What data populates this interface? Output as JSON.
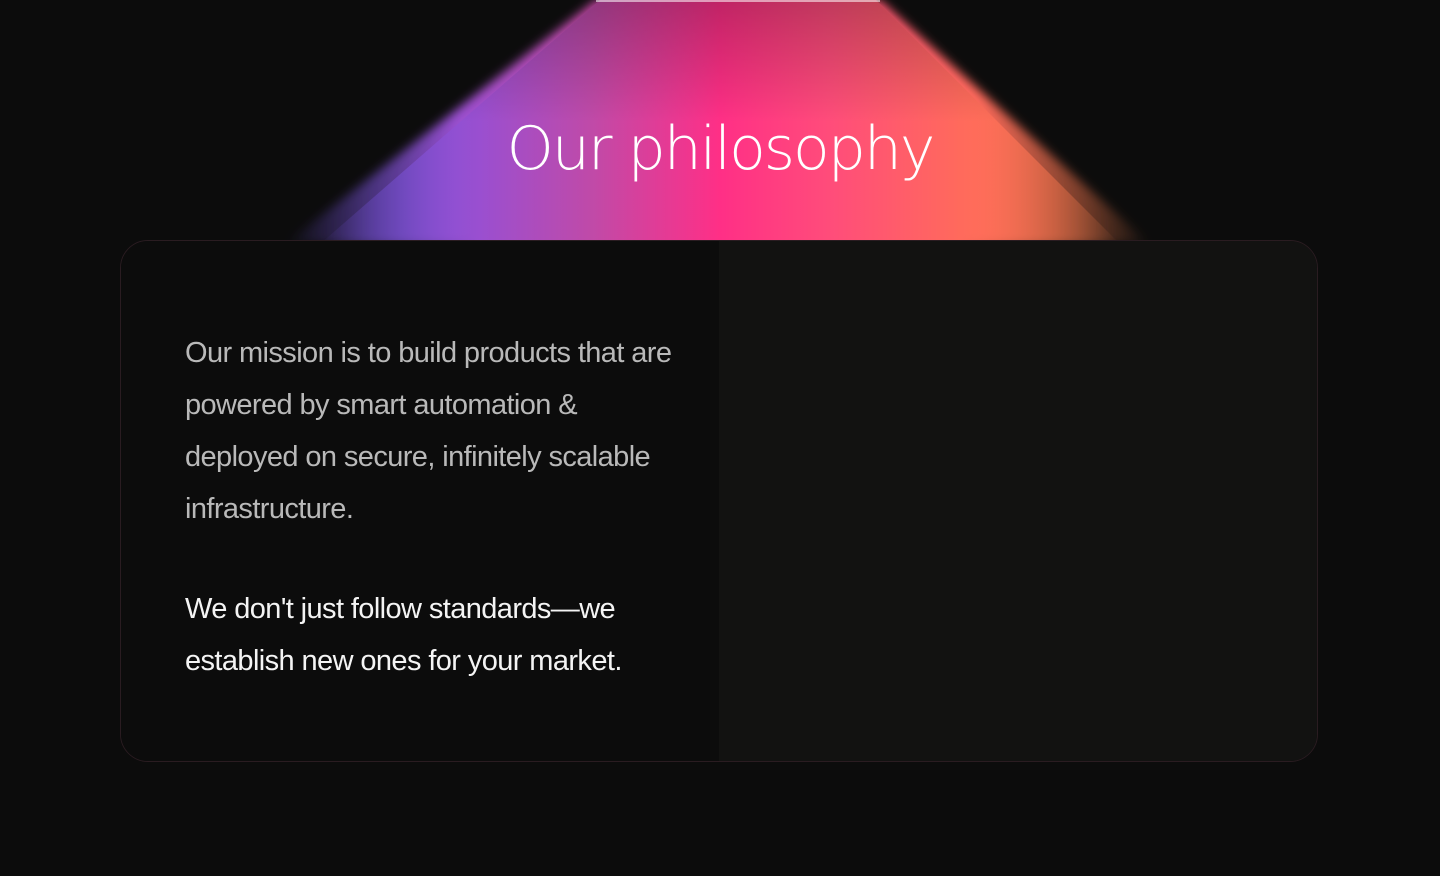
{
  "section": {
    "title": "Our philosophy"
  },
  "card": {
    "mission_text": "Our mission is to build products that are powered by smart automation & deployed on secure, infinitely scalable infrastructure.",
    "standards_text": "We don't just follow standards—we establish new ones for your market."
  },
  "colors": {
    "background": "#0c0c0c",
    "beam_purple": "#8e4fd6",
    "beam_pink": "#ff2f86",
    "beam_coral": "#ff6a5c",
    "card_right_panel": "#121211",
    "mission_text": "#b9b9b9",
    "standards_text": "#f4f4f4"
  }
}
